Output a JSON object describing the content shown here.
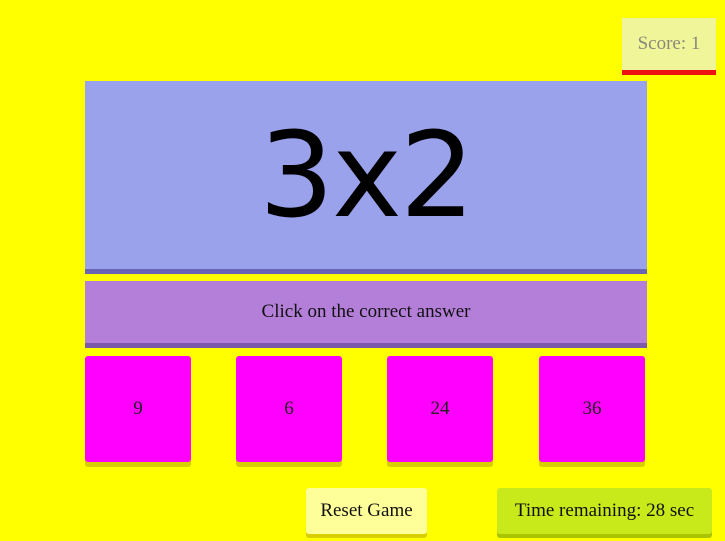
{
  "score": {
    "text": "Score: 1"
  },
  "question": {
    "text": "3x2"
  },
  "instruction": {
    "text": "Click on the correct answer"
  },
  "choices": [
    {
      "label": "9"
    },
    {
      "label": "6"
    },
    {
      "label": "24"
    },
    {
      "label": "36"
    }
  ],
  "controls": {
    "reset_label": "Reset Game",
    "timer_text": "Time remaining: 28 sec"
  },
  "colors": {
    "background": "#ffff00",
    "question_box": "#9aa2ec",
    "instruction_box": "#b47fd9",
    "choice_tile": "#ff00ff",
    "reset_button": "#ffff99",
    "timer_box": "#c8ea1a",
    "score_underline": "#ee1111"
  }
}
